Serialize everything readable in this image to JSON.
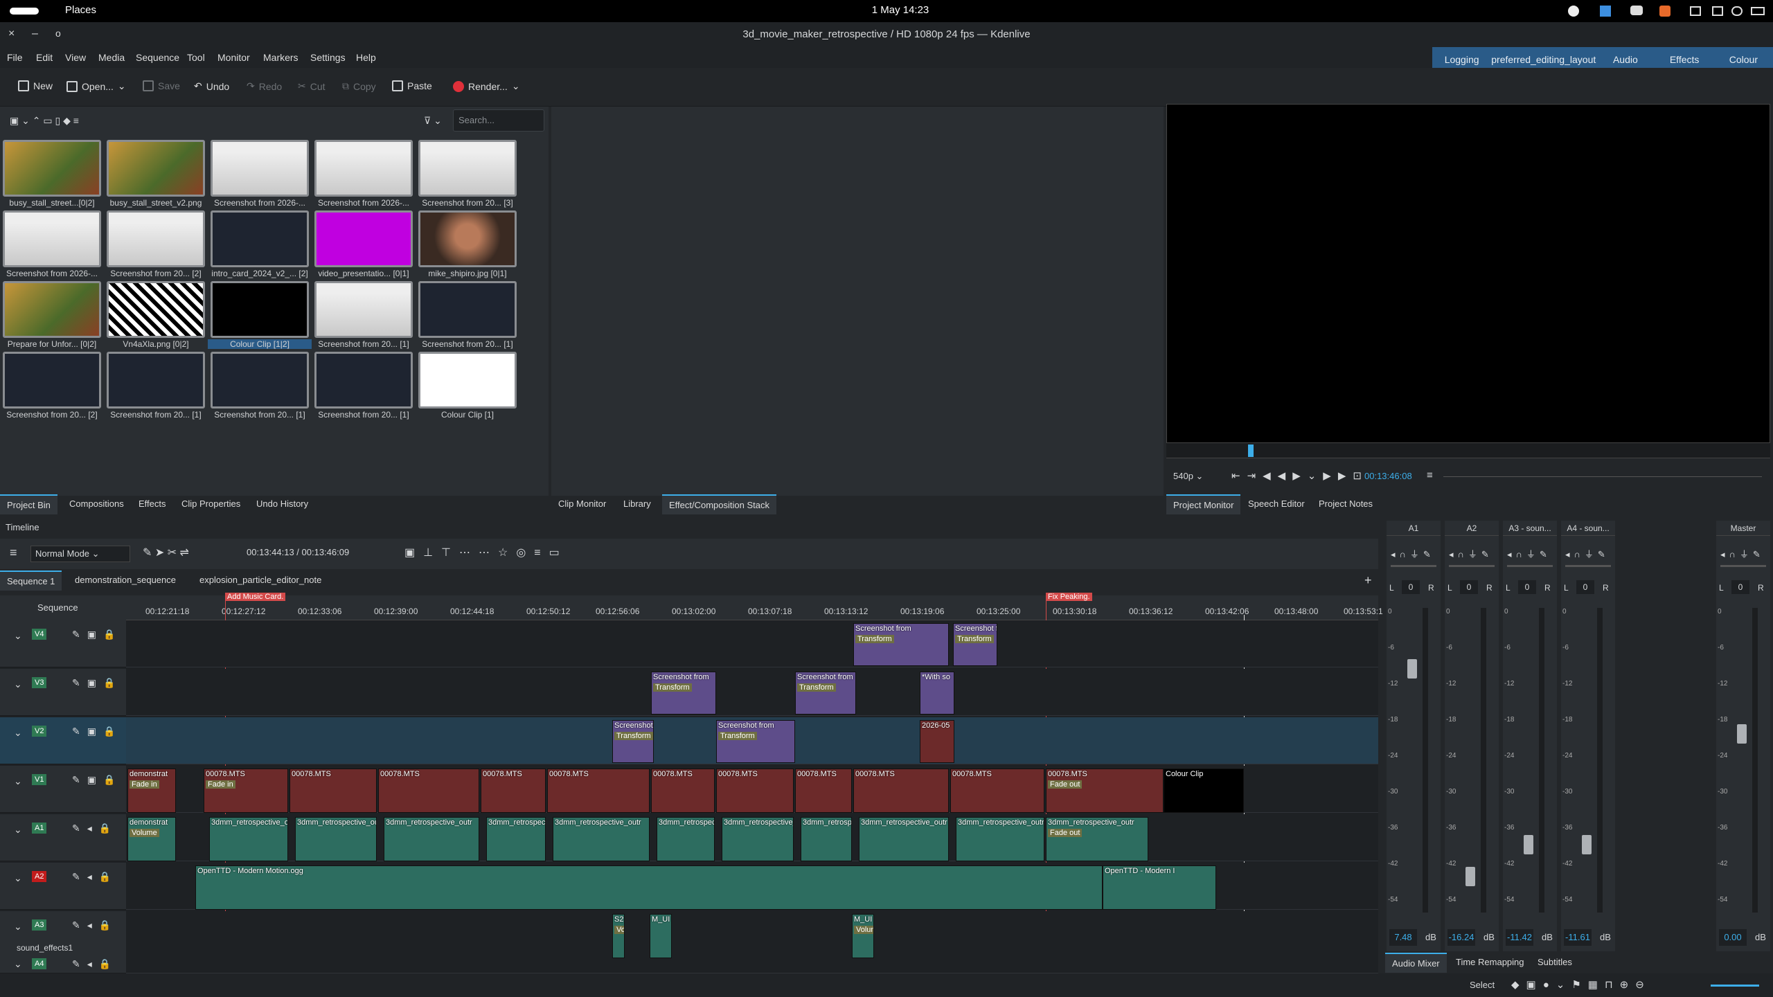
{
  "system": {
    "places": "Places",
    "clock": "1 May  14:23"
  },
  "window": {
    "title": "3d_movie_maker_retrospective / HD 1080p 24 fps — Kdenlive",
    "controls": [
      "×",
      "–",
      "o"
    ]
  },
  "menu": [
    "File",
    "Edit",
    "View",
    "Media",
    "Sequence",
    "Tool",
    "Monitor",
    "Markers",
    "Settings",
    "Help"
  ],
  "layouts": [
    "Logging",
    "preferred_editing_layout",
    "Audio",
    "Effects",
    "Colour"
  ],
  "toolbar": {
    "new": "New",
    "open": "Open...",
    "save": "Save",
    "undo": "Undo",
    "redo": "Redo",
    "cut": "Cut",
    "copy": "Copy",
    "paste": "Paste",
    "render": "Render..."
  },
  "bin": {
    "search_placeholder": "Search...",
    "items": [
      {
        "label": "busy_stall_street...[0|2]",
        "kind": "photo"
      },
      {
        "label": "busy_stall_street_v2.png",
        "kind": "photo"
      },
      {
        "label": "Screenshot from 2026-...",
        "kind": "doc"
      },
      {
        "label": "Screenshot from 2026-...",
        "kind": "doc"
      },
      {
        "label": "Screenshot from 20... [3]",
        "kind": "doc"
      },
      {
        "label": "Screenshot from 2026-...",
        "kind": "doc"
      },
      {
        "label": "Screenshot from 20... [2]",
        "kind": "doc"
      },
      {
        "label": "intro_card_2024_v2_... [2]",
        "kind": "dark"
      },
      {
        "label": "video_presentatio... [0|1]",
        "kind": "magenta"
      },
      {
        "label": "mike_shipiro.jpg [0|1]",
        "kind": "portrait"
      },
      {
        "label": "Prepare for Unfor... [0|2]",
        "kind": "photo"
      },
      {
        "label": "Vn4aXla.png [0|2]",
        "kind": "bw"
      },
      {
        "label": "Colour Clip [1|2]",
        "kind": "black"
      },
      {
        "label": "Screenshot from 20... [1]",
        "kind": "doc"
      },
      {
        "label": "Screenshot from 20... [1]",
        "kind": "dark"
      },
      {
        "label": "Screenshot from 20... [2]",
        "kind": "dark"
      },
      {
        "label": "Screenshot from 20... [1]",
        "kind": "dark"
      },
      {
        "label": "Screenshot from 20... [1]",
        "kind": "dark"
      },
      {
        "label": "Screenshot from 20... [1]",
        "kind": "dark"
      },
      {
        "label": "Colour Clip [1]",
        "kind": "white"
      }
    ],
    "tabs": [
      "Project Bin",
      "Compositions",
      "Effects",
      "Clip Properties",
      "Undo History"
    ]
  },
  "clip_monitor_tabs": [
    "Clip Monitor",
    "Library",
    "Effect/Composition Stack"
  ],
  "project_monitor": {
    "resolution": "540p",
    "timecode": "00:13:46:08",
    "tabs": [
      "Project Monitor",
      "Speech Editor",
      "Project Notes"
    ]
  },
  "timeline": {
    "title": "Timeline",
    "mode": "Normal Mode",
    "position": "00:13:44:13 / 00:13:46:09",
    "sequence_tabs": [
      "Sequence 1",
      "demonstration_sequence",
      "explosion_particle_editor_note"
    ],
    "sequence_label": "Sequence",
    "ruler": [
      "00:12:21:18",
      "00:12:27:12",
      "00:12:33:06",
      "00:12:39:00",
      "00:12:44:18",
      "00:12:50:12",
      "00:12:56:06",
      "00:13:02:00",
      "00:13:07:18",
      "00:13:13:12",
      "00:13:19:06",
      "00:13:25:00",
      "00:13:30:18",
      "00:13:36:12",
      "00:13:42:06",
      "00:13:48:00",
      "00:13:53:1"
    ],
    "markers": [
      "Add Music Card.",
      "Fix Peaking."
    ],
    "tracks": [
      {
        "name": "V4",
        "type": "video"
      },
      {
        "name": "V3",
        "type": "video"
      },
      {
        "name": "V2",
        "type": "video"
      },
      {
        "name": "V1",
        "type": "video"
      },
      {
        "name": "A1",
        "type": "audio"
      },
      {
        "name": "A2",
        "type": "audio"
      },
      {
        "name": "A3",
        "type": "audio",
        "sub": "sound_effects1"
      },
      {
        "name": "A4",
        "type": "audio"
      }
    ],
    "clip_texts": {
      "screenshot": "Screenshot from",
      "transform": "Transform",
      "mts": "00078.MTS",
      "fade_in": "Fade in",
      "fade_out": "Fade out",
      "retro": "3dmm_retrospective_outr",
      "demonstrat": "demonstrat",
      "volume": "Volume",
      "with": "*With so",
      "date": "2026-05",
      "colour": "Colour Clip",
      "music": "OpenTTD - Modern Motion.ogg",
      "music2": "OpenTTD - Modern I",
      "s2": "S2",
      "mui": "M_UI",
      "vo": "Vo",
      "volun": "Volun"
    }
  },
  "mixer": {
    "strips": [
      {
        "name": "A1",
        "value": "7.48"
      },
      {
        "name": "A2",
        "value": "-16.24"
      },
      {
        "name": "A3 - soun...",
        "value": "-11.42"
      },
      {
        "name": "A4 - soun...",
        "value": "-11.61"
      },
      {
        "name": "Master",
        "value": "0.00"
      }
    ],
    "db": "dB",
    "pan_value": "0",
    "scale": [
      "0",
      "-6",
      "-12",
      "-18",
      "-24",
      "-30",
      "-36",
      "-42",
      "-54"
    ],
    "tabs": [
      "Audio Mixer",
      "Time Remapping",
      "Subtitles"
    ]
  },
  "status": {
    "select": "Select"
  }
}
